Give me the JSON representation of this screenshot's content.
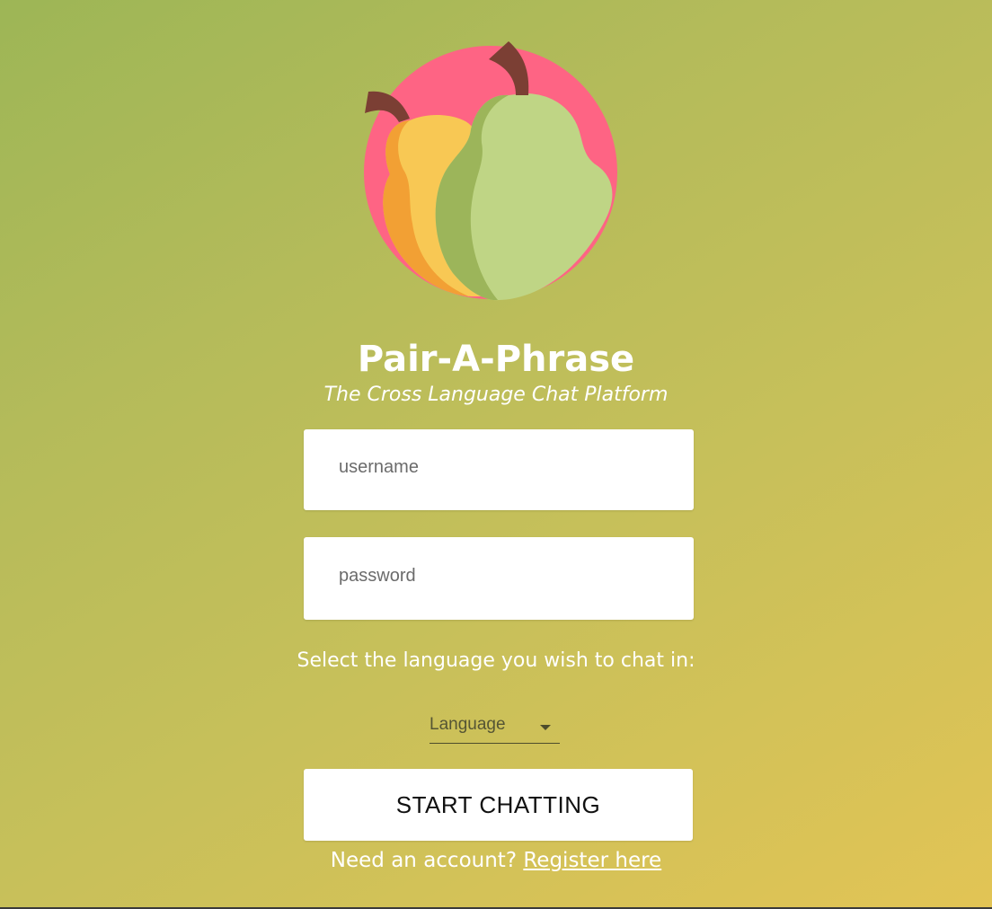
{
  "app": {
    "title": "Pair-A-Phrase",
    "subtitle": "The Cross Language Chat Platform"
  },
  "logo": {
    "icon": "pear-logo-icon",
    "colors": {
      "circle": "#fe6484",
      "pear_back_light": "#f8c854",
      "pear_back_dark": "#f2a034",
      "pear_front_light": "#bfd585",
      "pear_front_dark": "#9cb55a",
      "stem": "#7b3f34"
    }
  },
  "form": {
    "username_placeholder": "username",
    "password_placeholder": "password",
    "language_prompt": "Select the language you wish to chat in:",
    "language_select_value": "Language",
    "submit_label": "START CHATTING"
  },
  "footer": {
    "prompt": "Need an account?",
    "link_label": "Register here"
  },
  "theme": {
    "gradient_start": "#9db656",
    "gradient_end": "#e2c455",
    "text": "#ffffff"
  }
}
